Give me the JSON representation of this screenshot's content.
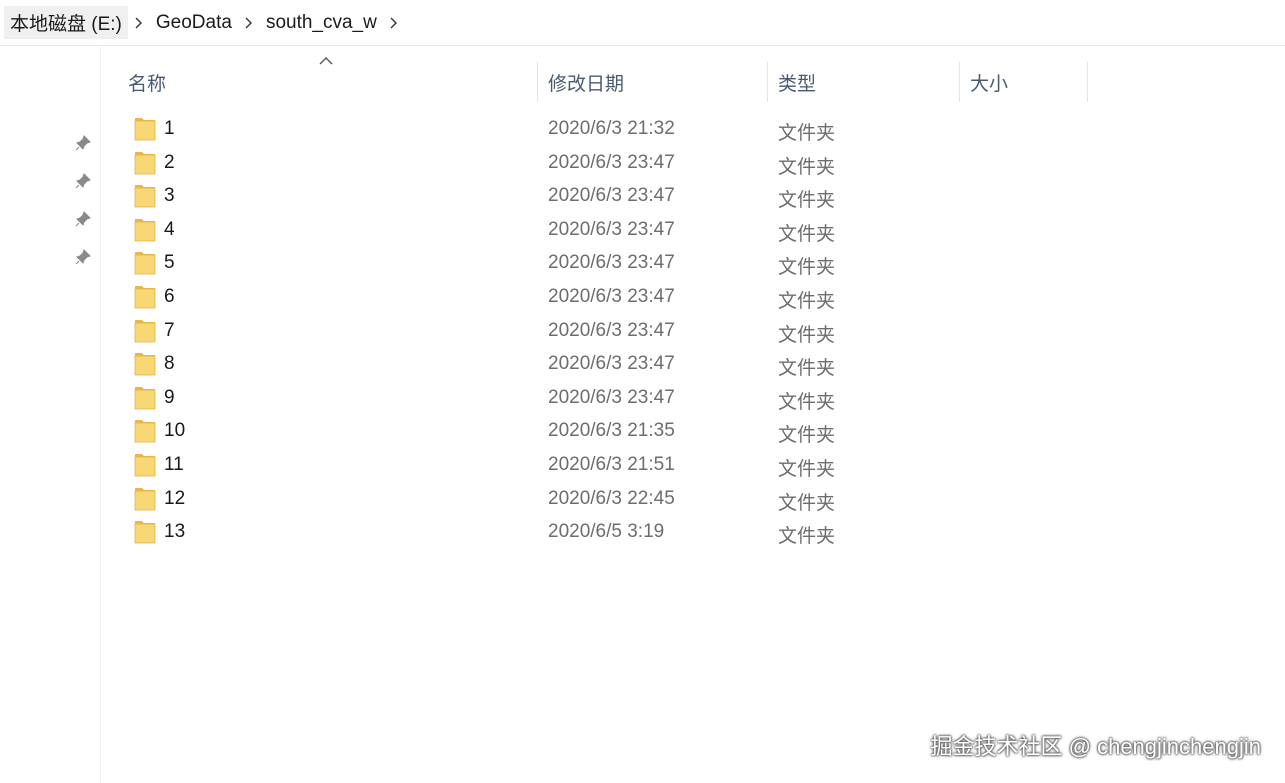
{
  "breadcrumb": {
    "items": [
      "本地磁盘 (E:)",
      "GeoData",
      "south_cva_w"
    ]
  },
  "columns": {
    "name": "名称",
    "date": "修改日期",
    "type": "类型",
    "size": "大小",
    "sort_indicator": "ascending"
  },
  "rows": [
    {
      "name": "1",
      "date": "2020/6/3 21:32",
      "type": "文件夹"
    },
    {
      "name": "2",
      "date": "2020/6/3 23:47",
      "type": "文件夹"
    },
    {
      "name": "3",
      "date": "2020/6/3 23:47",
      "type": "文件夹"
    },
    {
      "name": "4",
      "date": "2020/6/3 23:47",
      "type": "文件夹"
    },
    {
      "name": "5",
      "date": "2020/6/3 23:47",
      "type": "文件夹"
    },
    {
      "name": "6",
      "date": "2020/6/3 23:47",
      "type": "文件夹"
    },
    {
      "name": "7",
      "date": "2020/6/3 23:47",
      "type": "文件夹"
    },
    {
      "name": "8",
      "date": "2020/6/3 23:47",
      "type": "文件夹"
    },
    {
      "name": "9",
      "date": "2020/6/3 23:47",
      "type": "文件夹"
    },
    {
      "name": "10",
      "date": "2020/6/3 21:35",
      "type": "文件夹"
    },
    {
      "name": "11",
      "date": "2020/6/3 21:51",
      "type": "文件夹"
    },
    {
      "name": "12",
      "date": "2020/6/3 22:45",
      "type": "文件夹"
    },
    {
      "name": "13",
      "date": "2020/6/5 3:19",
      "type": "文件夹"
    }
  ],
  "icons": {
    "folder": "folder-icon",
    "pin": "pin-icon",
    "separator": "chevron-right-icon",
    "sort": "sort-up-icon"
  },
  "colors": {
    "folder_fill": "#f8d775",
    "header_text": "#4a5a70",
    "muted_text": "#6d6d6d"
  },
  "watermark": "掘金技术社区 @ chengjinchengjin"
}
